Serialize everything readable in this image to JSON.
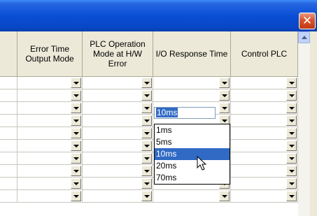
{
  "window": {
    "close_glyph": "✕"
  },
  "table": {
    "columns": [
      {
        "label": ""
      },
      {
        "label": "Error Time Output Mode"
      },
      {
        "label": "PLC Operation Mode at H/W Error"
      },
      {
        "label": "I/O Response Time"
      },
      {
        "label": "Control PLC"
      }
    ],
    "row_count": 10,
    "editing": {
      "row": 2,
      "column": 3,
      "value": "10ms"
    }
  },
  "dropdown_list": {
    "options": [
      "1ms",
      "5ms",
      "10ms",
      "20ms",
      "70ms"
    ],
    "selected": "10ms"
  },
  "colors": {
    "titlebar": "#0a4fd6",
    "selection": "#316ac5",
    "header_bg": "#ece9d8"
  },
  "icons": {
    "close": "close-icon",
    "dropdown": "chevron-down-icon",
    "cursor": "mouse-pointer-icon",
    "scroll_up": "scroll-up-icon"
  }
}
